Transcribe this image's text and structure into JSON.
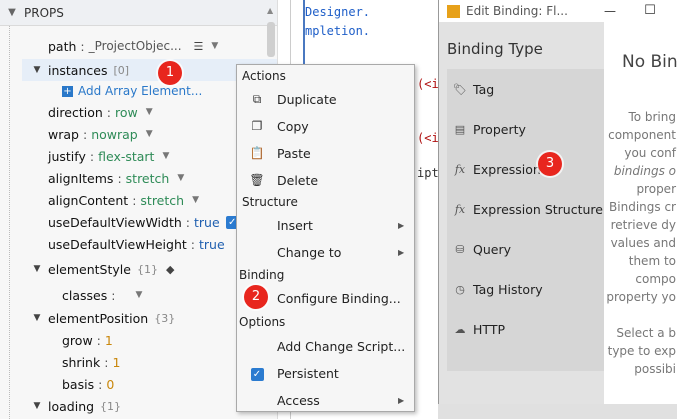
{
  "props": {
    "header": "PROPS",
    "rows": {
      "path": {
        "key": "path",
        "value": "_ProjectObjec..."
      },
      "instances": {
        "key": "instances",
        "count": "[0]"
      },
      "add_array": "Add Array Element...",
      "direction": {
        "key": "direction",
        "value": "row"
      },
      "wrap": {
        "key": "wrap",
        "value": "nowrap"
      },
      "justify": {
        "key": "justify",
        "value": "flex-start"
      },
      "alignItems": {
        "key": "alignItems",
        "value": "stretch"
      },
      "alignContent": {
        "key": "alignContent",
        "value": "stretch"
      },
      "useDefaultViewWidth": {
        "key": "useDefaultViewWidth",
        "value": "true"
      },
      "useDefaultViewHeight": {
        "key": "useDefaultViewHeight",
        "value": "true"
      },
      "elementStyle": {
        "key": "elementStyle",
        "count": "{1}"
      },
      "classes": {
        "key": "classes"
      },
      "elementPosition": {
        "key": "elementPosition",
        "count": "{3}"
      },
      "grow": {
        "key": "grow",
        "value": "1"
      },
      "shrink": {
        "key": "shrink",
        "value": "1"
      },
      "basis": {
        "key": "basis",
        "value": "0"
      },
      "loading": {
        "key": "loading",
        "count": "{1}"
      }
    }
  },
  "editor": {
    "lines": [
      "Designer.",
      "mpletion.",
      "(<i",
      "(<i",
      "ipt"
    ]
  },
  "context_menu": {
    "actions_label": "Actions",
    "duplicate": "Duplicate",
    "copy": "Copy",
    "paste": "Paste",
    "delete": "Delete",
    "structure_label": "Structure",
    "insert": "Insert",
    "change_to": "Change to",
    "binding_label": "Binding",
    "configure_binding": "Configure Binding...",
    "options_label": "Options",
    "add_change_script": "Add Change Script...",
    "persistent": "Persistent",
    "access": "Access"
  },
  "binding_dialog": {
    "title": "Edit Binding: Fl...",
    "binding_type_label": "Binding Type",
    "types": [
      "Tag",
      "Property",
      "Expression",
      "Expression Structure",
      "Query",
      "Tag History",
      "HTTP"
    ],
    "no_binding_title": "No Bin",
    "help": [
      "To bring",
      "component",
      "you conf",
      "bindings o",
      "proper",
      "Bindings cr",
      "retrieve dy",
      "values and",
      "them to",
      "compo",
      "property yo",
      "Select a b",
      "type to exp",
      "possibi"
    ]
  },
  "badges": [
    "1",
    "2",
    "3"
  ],
  "colors": {
    "accent": "#2b7bd0",
    "badge": "#e8261e",
    "string_value": "#2e8b57",
    "number_value": "#c9870c",
    "bool_value": "#2060b0"
  }
}
